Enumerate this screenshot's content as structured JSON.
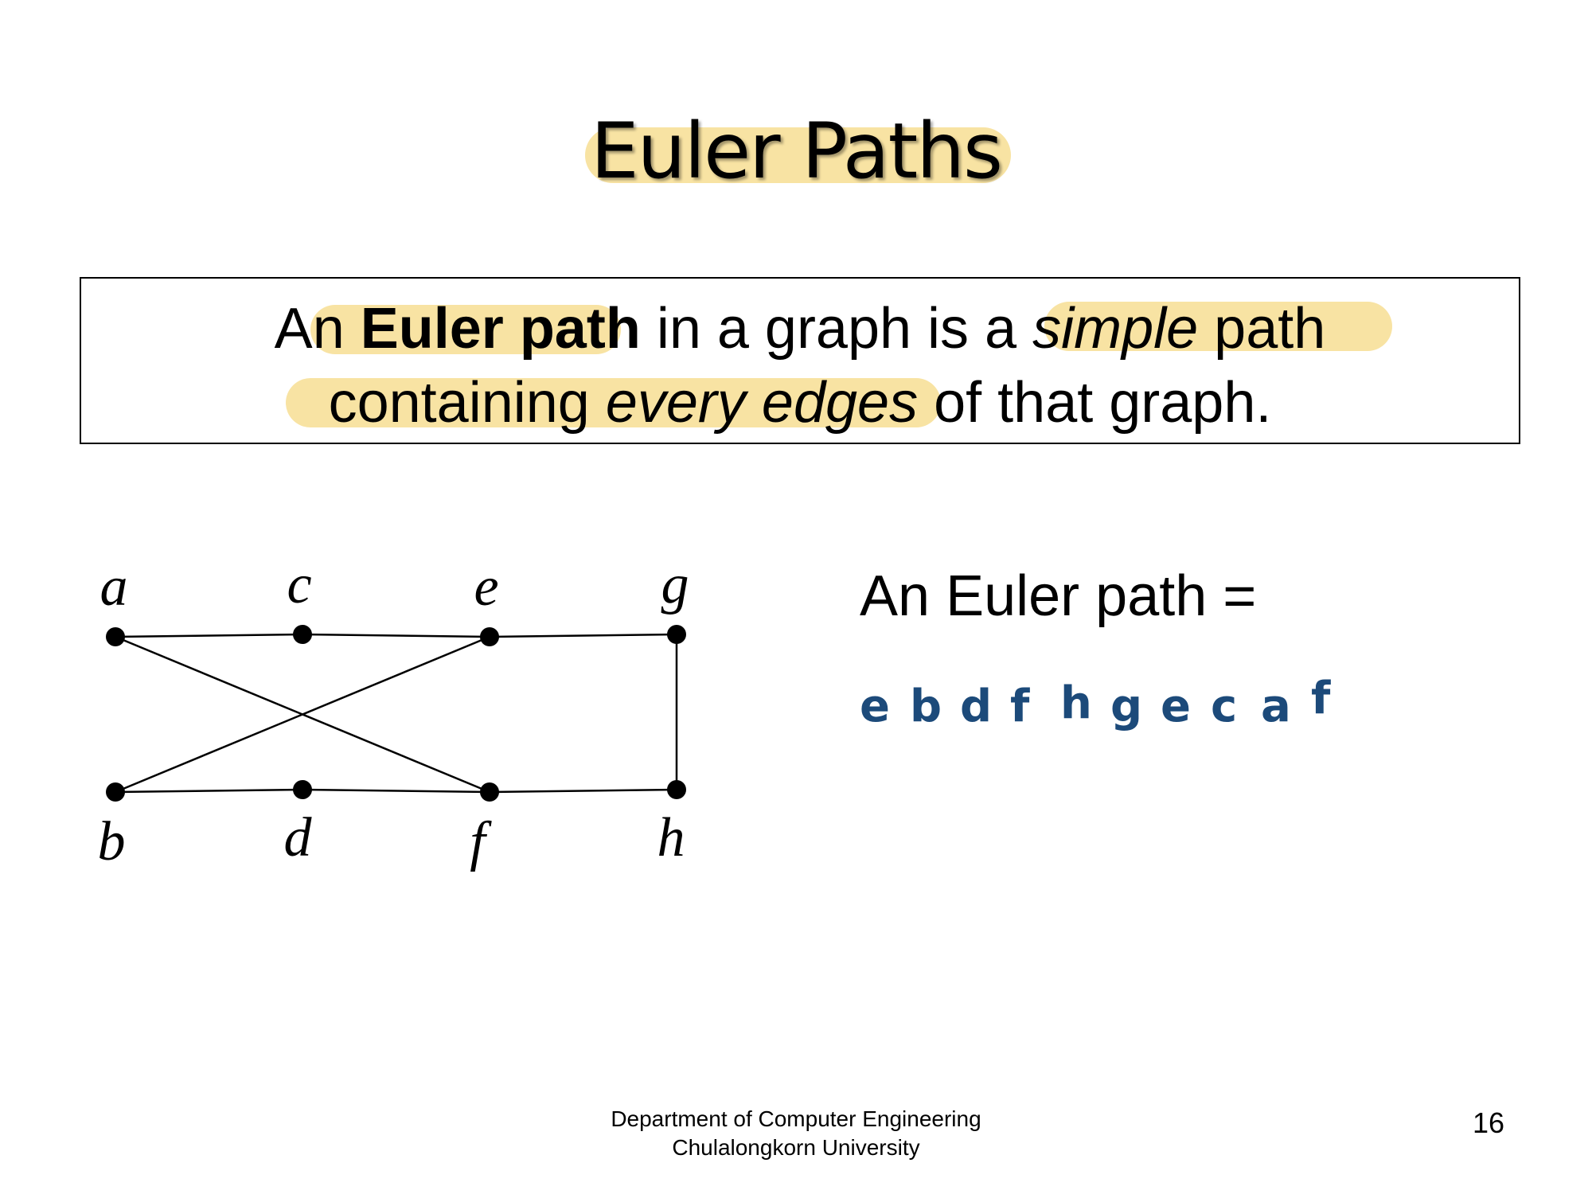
{
  "slide": {
    "title": "Euler Paths",
    "definition": {
      "line1": {
        "before": "An ",
        "term": "Euler path",
        "middle": " in a graph is a ",
        "emph": "simple",
        "after": " path"
      },
      "line2": {
        "before": "containing ",
        "emph": "every edges",
        "after": " of that graph."
      }
    },
    "answer_label": "An Euler path =",
    "euler_path": [
      "e",
      "b",
      "d",
      "f",
      "h",
      "g",
      "e",
      "c",
      "a",
      "f"
    ],
    "footer": {
      "line1": "Department of Computer Engineering",
      "line2": "Chulalongkorn University"
    },
    "page_number": "16"
  },
  "graph": {
    "vertices": [
      "a",
      "c",
      "e",
      "g",
      "b",
      "d",
      "f",
      "h"
    ],
    "edges": [
      [
        "a",
        "c"
      ],
      [
        "c",
        "e"
      ],
      [
        "e",
        "g"
      ],
      [
        "g",
        "h"
      ],
      [
        "b",
        "d"
      ],
      [
        "d",
        "f"
      ],
      [
        "f",
        "h"
      ],
      [
        "a",
        "f"
      ],
      [
        "b",
        "e"
      ]
    ]
  },
  "colors": {
    "highlight": "#f8e3a3",
    "handwriting": "#1c4a7a"
  }
}
